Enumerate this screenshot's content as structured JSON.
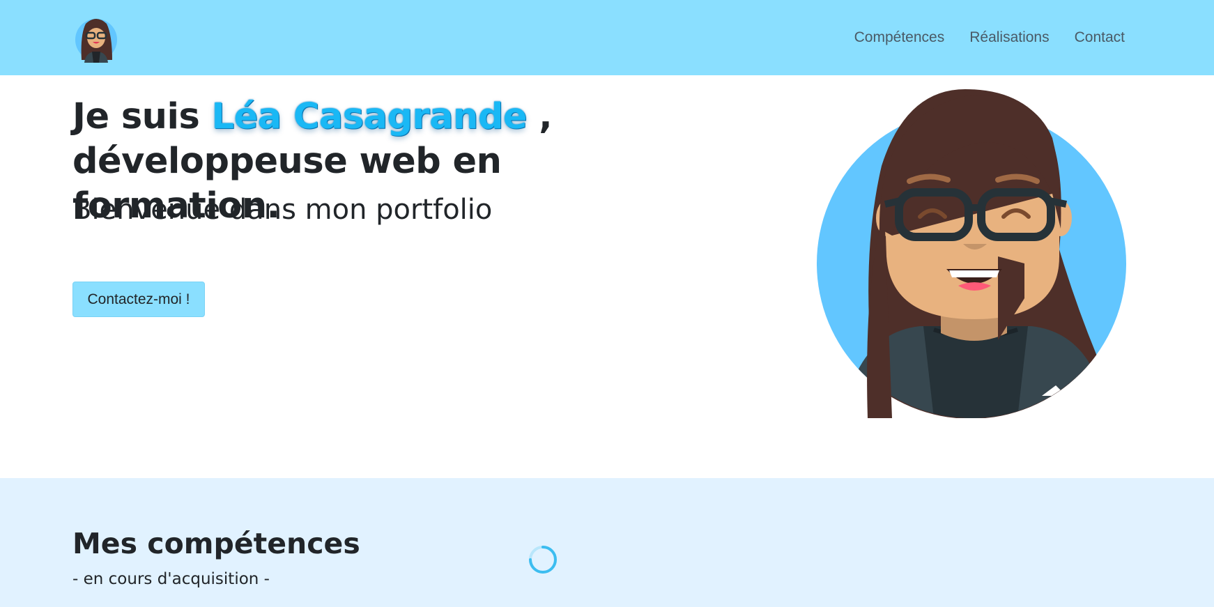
{
  "nav": {
    "logo_icon": "avatar-logo-icon",
    "links": [
      {
        "label": "Compétences"
      },
      {
        "label": "Réalisations"
      },
      {
        "label": "Contact"
      }
    ]
  },
  "hero": {
    "title_prefix": "Je suis",
    "name": "Léa Casagrande",
    "title_comma": ",",
    "title_line2": "développeuse web en formation.",
    "subtitle": "Bienvenue dans mon portfolio",
    "cta_label": "Contactez-moi !",
    "avatar_icon": "avatar-illustration"
  },
  "skills": {
    "title": "Mes compétences",
    "subtitle": "- en cours d'acquisition -",
    "loader_icon": "spinner-icon"
  },
  "colors": {
    "navbar_bg": "#8adfff",
    "accent": "#1ab8f5",
    "skills_bg": "#e1f2ff",
    "text": "#212529"
  }
}
